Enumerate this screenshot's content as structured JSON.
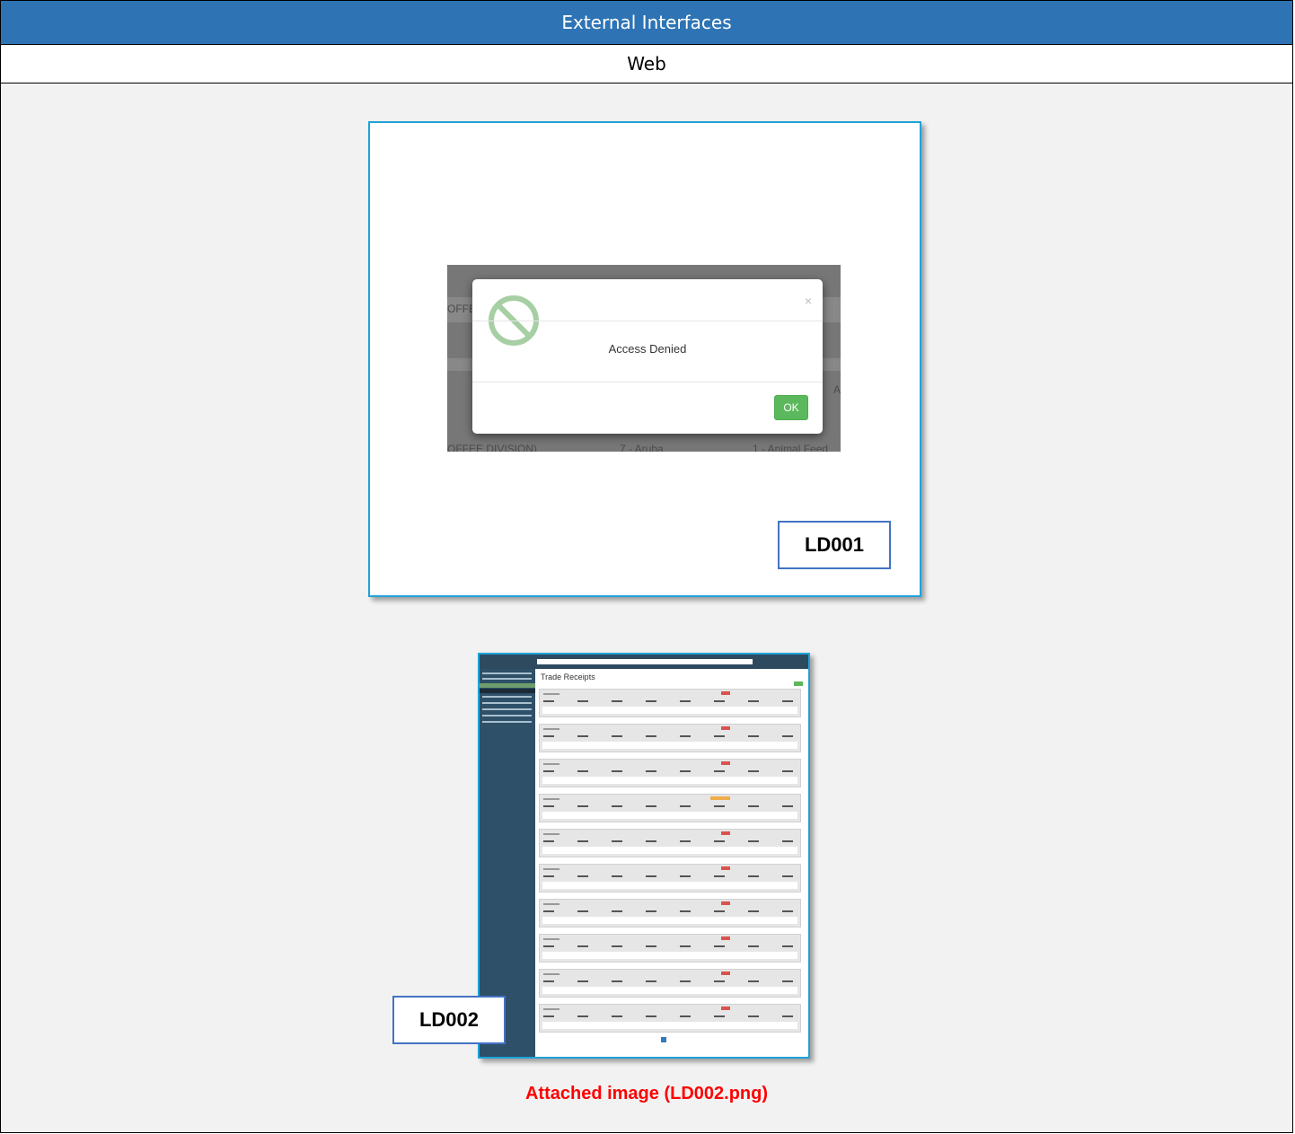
{
  "header": {
    "title": "External Interfaces"
  },
  "subheader": {
    "title": "Web"
  },
  "figure1": {
    "dialog_message": "Access Denied",
    "dialog_close": "×",
    "dialog_ok": "OK",
    "bg_text_1": "OFFEE",
    "bg_text_2": "A",
    "bg_text_3": "OFFEE DIVISION)",
    "bg_text_4": "7 - Aruba",
    "bg_text_5": "1 - Animal Feed",
    "tag": "LD001"
  },
  "figure2": {
    "page_title": "Trade Receipts",
    "tag": "LD002"
  },
  "caption": "Attached image (LD002.png)",
  "colors": {
    "header_bg": "#2e74b5",
    "frame_border": "#1fa2d8",
    "tag_border": "#4472c4",
    "caption": "#ff0000",
    "ok_button": "#5cb85c"
  }
}
